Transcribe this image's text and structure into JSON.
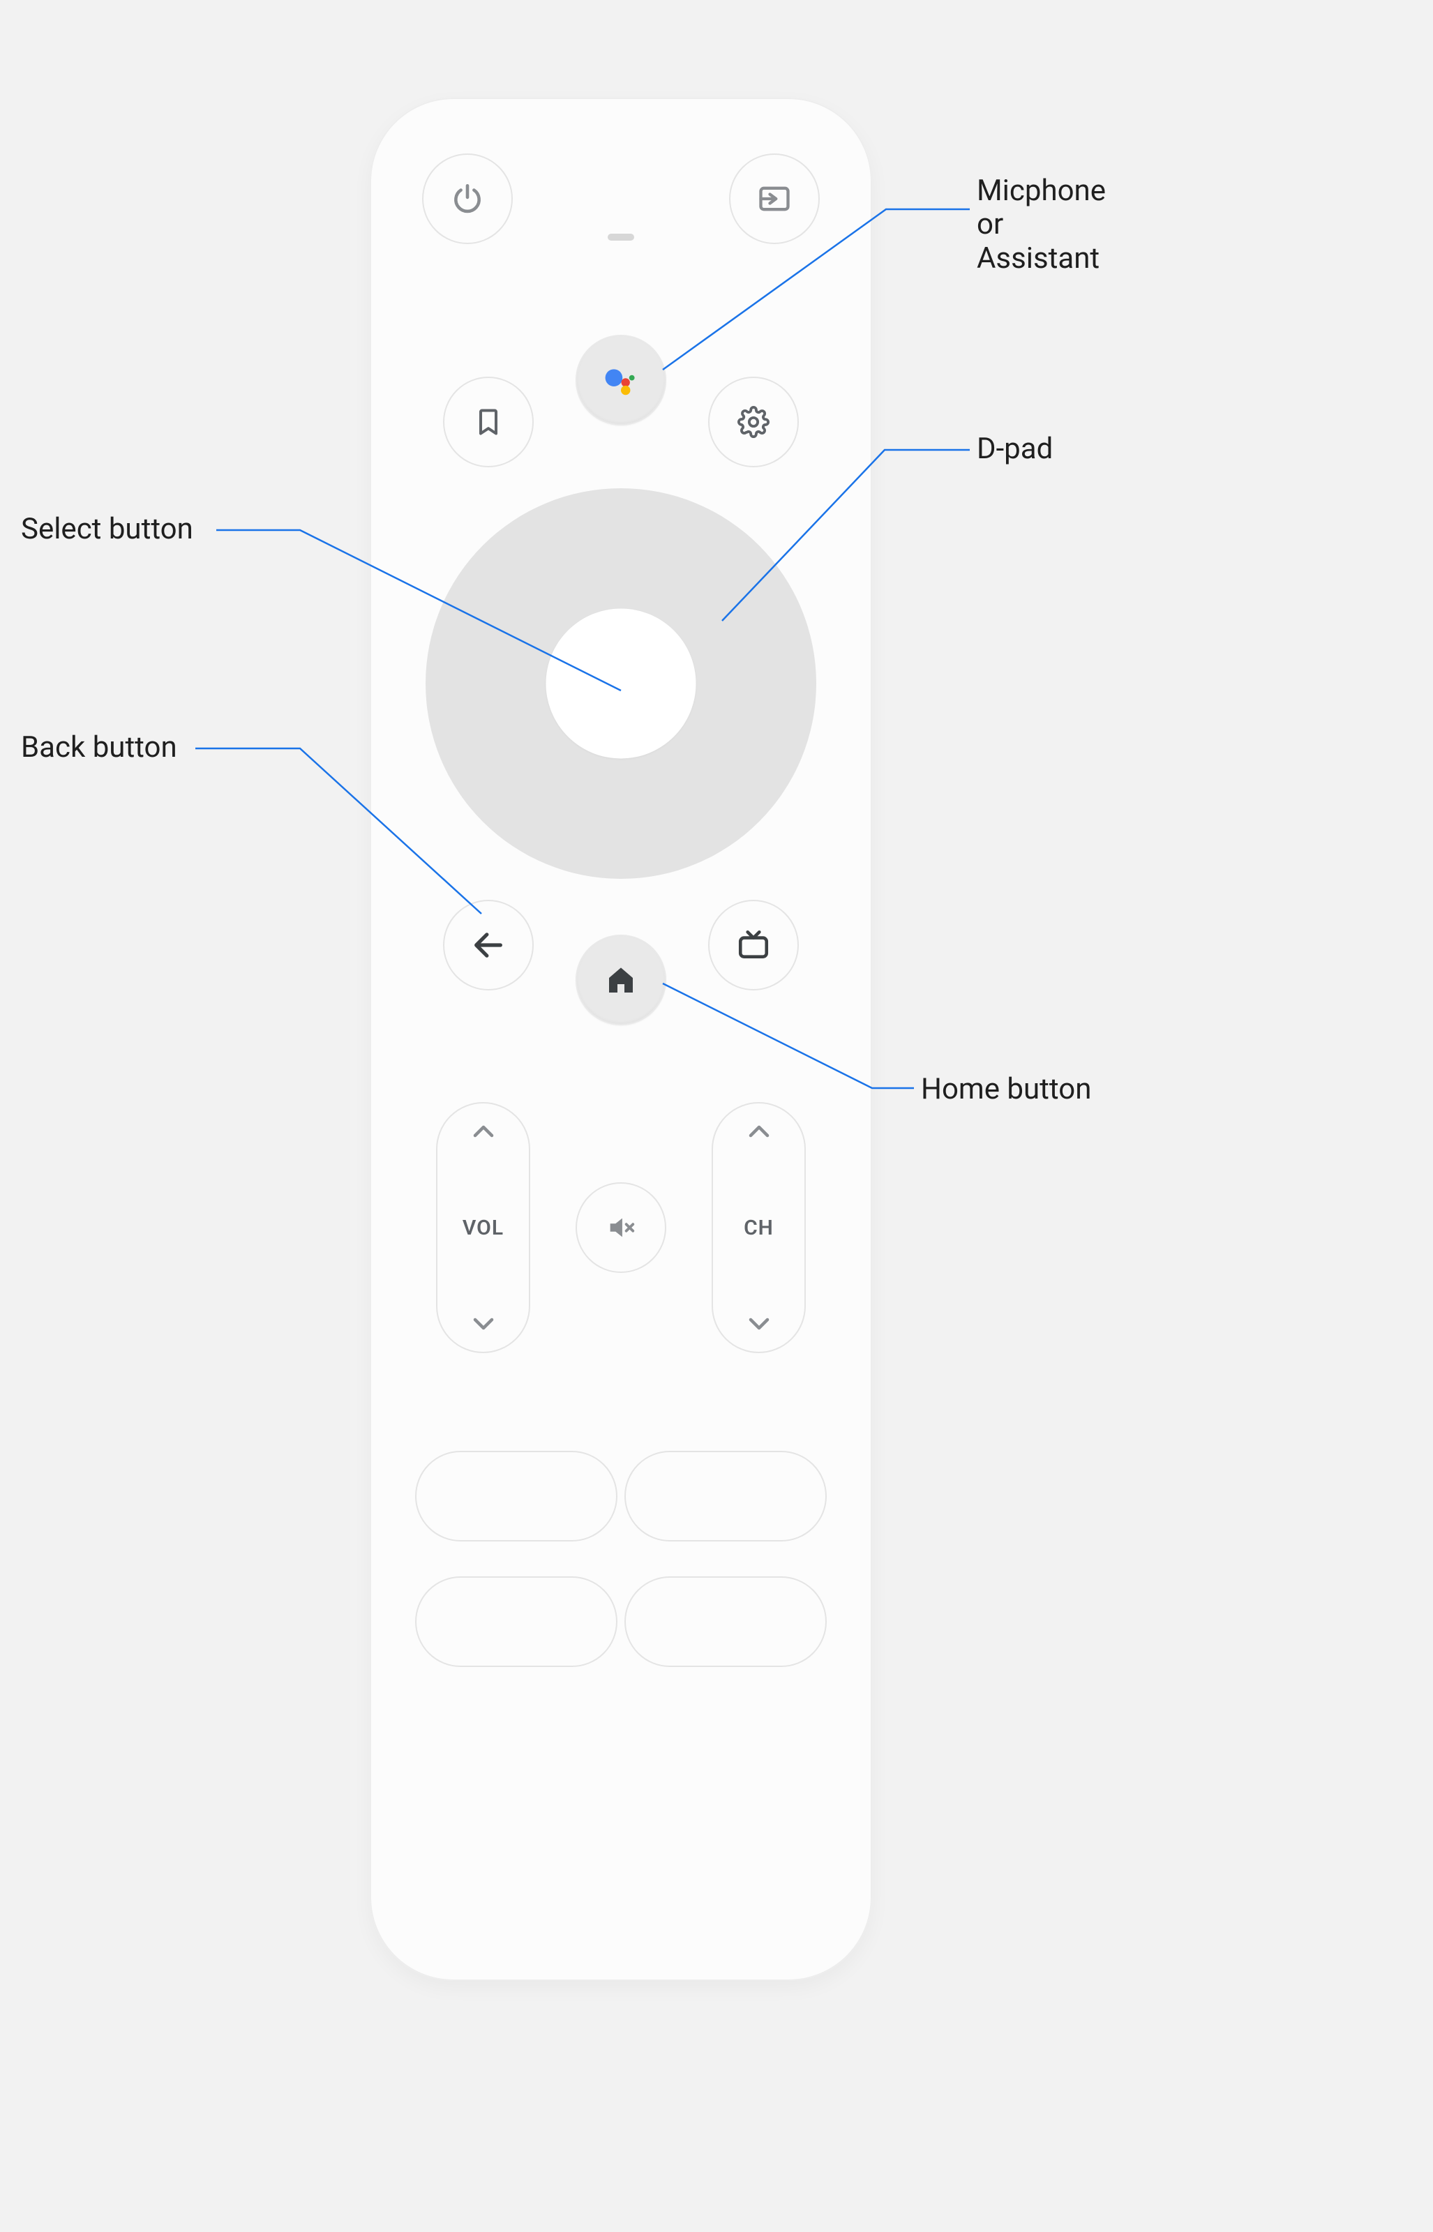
{
  "callouts": {
    "assistant": "Micphone\nor\nAssistant",
    "dpad": "D-pad",
    "select": "Select button",
    "back": "Back button",
    "home": "Home button"
  },
  "rockers": {
    "vol_label": "VOL",
    "ch_label": "CH"
  },
  "buttons": {
    "power": "power",
    "input": "input",
    "assistant": "assistant",
    "bookmark": "bookmark",
    "settings": "settings",
    "back": "back",
    "home": "home",
    "guide": "guide",
    "mute": "mute"
  }
}
